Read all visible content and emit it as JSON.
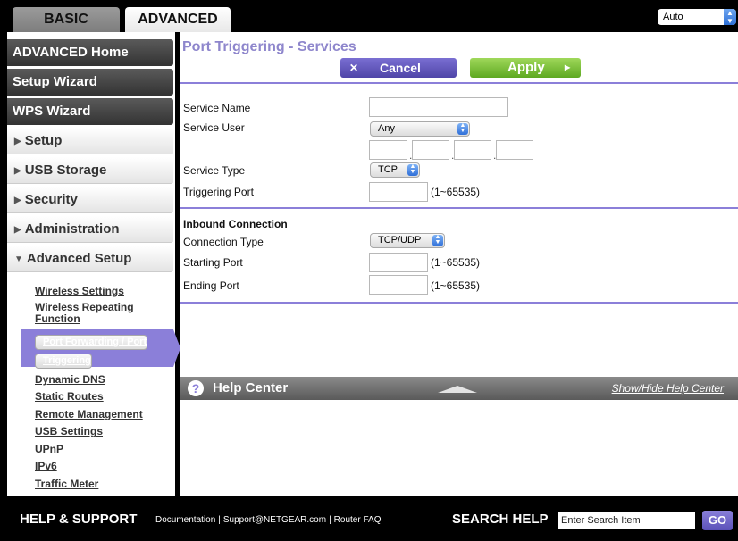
{
  "tabs": {
    "basic": "BASIC",
    "advanced": "ADVANCED"
  },
  "language": {
    "value": "Auto"
  },
  "sidebar": {
    "main_items": [
      "ADVANCED Home",
      "Setup Wizard",
      "WPS Wizard"
    ],
    "sections": [
      "Setup",
      "USB Storage",
      "Security",
      "Administration",
      "Advanced Setup"
    ],
    "sub_items": [
      "Wireless Settings",
      "Wireless Repeating",
      "Function",
      "Port Forwarding / Port",
      "Triggering",
      "Dynamic DNS",
      "Static Routes",
      "Remote Management",
      "USB Settings",
      "UPnP",
      "IPv6",
      "Traffic Meter"
    ]
  },
  "page": {
    "title": "Port Triggering - Services",
    "cancel": "Cancel",
    "apply": "Apply",
    "service_name_label": "Service Name",
    "service_user_label": "Service User",
    "service_user_value": "Any",
    "service_type_label": "Service Type",
    "service_type_value": "TCP",
    "triggering_port_label": "Triggering Port",
    "range": "(1~65535)",
    "inbound_heading": "Inbound Connection",
    "connection_type_label": "Connection Type",
    "connection_type_value": "TCP/UDP",
    "starting_port_label": "Starting Port",
    "ending_port_label": "Ending Port",
    "dot": "."
  },
  "help": {
    "title": "Help Center",
    "toggle": "Show/Hide Help Center",
    "icon": "?"
  },
  "footer": {
    "title": "HELP & SUPPORT",
    "links": [
      "Documentation",
      "Support@NETGEAR.com",
      "Router FAQ"
    ],
    "separator": "|",
    "search_label": "SEARCH HELP",
    "search_placeholder": "Enter Search Item",
    "go": "GO"
  }
}
